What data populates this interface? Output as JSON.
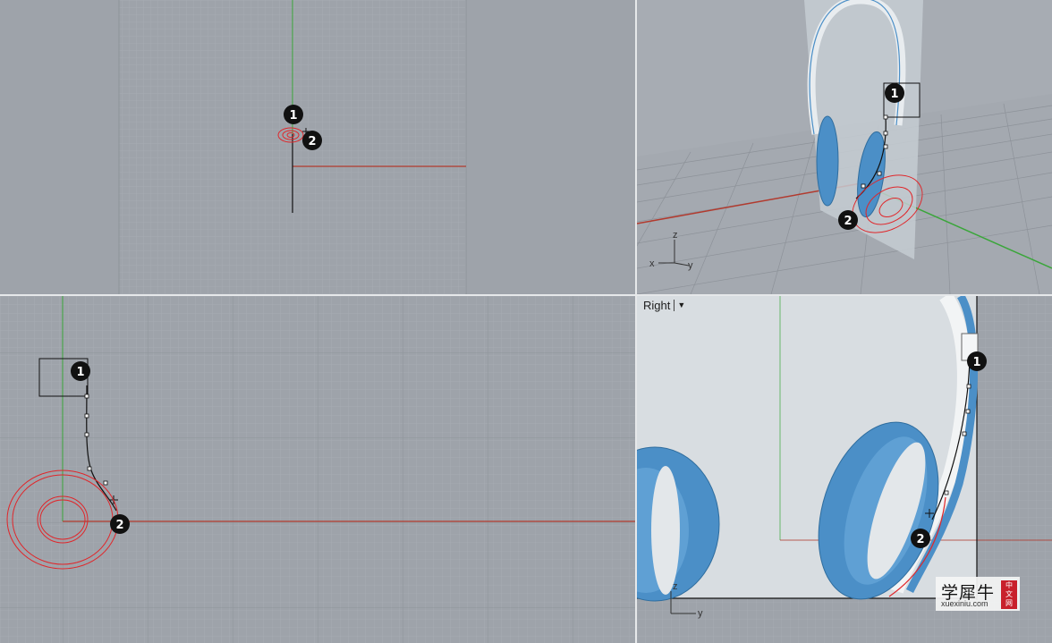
{
  "viewports": {
    "top": {
      "name": ""
    },
    "perspective": {
      "name": "",
      "axes": {
        "z": "z",
        "x": "x",
        "y": "y"
      }
    },
    "front": {
      "name": ""
    },
    "right": {
      "name": "Right",
      "menu_icon": "dropdown-arrow-icon",
      "axes": {
        "z": "z",
        "y": "y"
      }
    }
  },
  "markers": {
    "one": "1",
    "two": "2"
  },
  "watermark": {
    "brand": "学犀牛",
    "url": "xuexiniu.com",
    "seal": [
      "中",
      "文",
      "网"
    ]
  },
  "colors": {
    "viewport_bg": "#9ea3aa",
    "grid_minor": "#a9adb4",
    "grid_major": "#8e939a",
    "x_axis": "#b23a2e",
    "y_axis": "#3aa63a",
    "curve_red": "#e0262a",
    "headphone_blue": "#4b8fc7",
    "control_point": "#ffffff"
  }
}
